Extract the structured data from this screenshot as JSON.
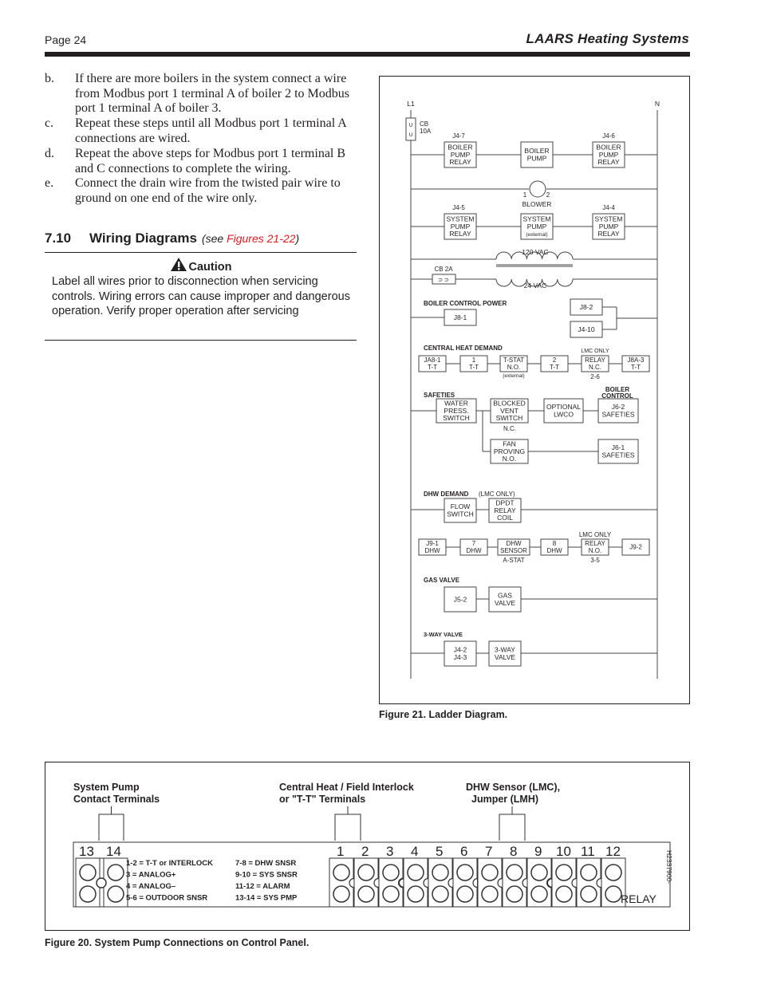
{
  "header": {
    "page_label": "Page 24",
    "brand": "LAARS Heating Systems"
  },
  "steps": [
    {
      "label": "b.",
      "text": "If there are more boilers in the system connect a wire from Modbus port 1 terminal A of boiler 2 to Modbus port 1 terminal A of boiler 3."
    },
    {
      "label": "c.",
      "text": "Repeat these steps until all Modbus port 1 terminal A connections are wired."
    },
    {
      "label": "d.",
      "text": "Repeat the above steps for Modbus port 1 terminal B and C connections to complete the wiring."
    },
    {
      "label": "e.",
      "text": "Connect the drain wire from the twisted pair wire to ground on one end of the wire only."
    }
  ],
  "section": {
    "number": "7.10",
    "title": "Wiring Diagrams",
    "see_prefix": "(see ",
    "see_ref": "Figures 21-22",
    "see_suffix": ")"
  },
  "caution": {
    "icon": "warning-triangle-icon",
    "title": "Caution",
    "body": "Label all wires prior to disconnection when servicing controls. Wiring errors can cause improper and dangerous operation. Verify proper operation after servicing"
  },
  "colors": {
    "text": "#231f20",
    "link_red": "#e21b23"
  },
  "figure21": {
    "caption": "Figure 21. Ladder Diagram.",
    "rails": {
      "left": "L1",
      "right": "N"
    },
    "cb10": [
      "CB",
      "10A"
    ],
    "rung1": {
      "left_tag": "J4-7",
      "left": [
        "BOILER",
        "PUMP",
        "RELAY"
      ],
      "mid": [
        "BOILER",
        "PUMP"
      ],
      "right_tag": "J4-6",
      "right": [
        "BOILER",
        "PUMP",
        "RELAY"
      ]
    },
    "blower": {
      "label": "BLOWER",
      "t1": "1",
      "t2": "2"
    },
    "rung3": {
      "left_tag": "J4-5",
      "left": [
        "SYSTEM",
        "PUMP",
        "RELAY"
      ],
      "mid": [
        "SYSTEM",
        "PUMP",
        "(external)"
      ],
      "right_tag": "J4-4",
      "right": [
        "SYSTEM",
        "PUMP",
        "RELAY"
      ]
    },
    "transformer": {
      "primary": "120 VAC",
      "secondary": "24 VAC"
    },
    "cb2": "CB 2A",
    "boiler_control_power": {
      "title": "BOILER CONTROL POWER",
      "left": "J8-1",
      "right_top": "J8-2",
      "right_bottom": "J4-10"
    },
    "central_heat": {
      "title": "CENTRAL HEAT DEMAND",
      "boxes": [
        [
          "JA8-1",
          "T-T"
        ],
        [
          "1",
          "T-T"
        ],
        [
          "T-STAT",
          "N.O."
        ],
        [
          "2",
          "T-T"
        ],
        [
          "RELAY",
          "N.C."
        ],
        [
          "J8A-3",
          "T-T"
        ]
      ],
      "tstat_note": "(external)",
      "relay_top": "LMC ONLY",
      "relay_bottom": "2-6"
    },
    "safeties": {
      "title": "SAFETIES",
      "boiler_control": [
        "BOILER",
        "CONTROL"
      ],
      "water": [
        "WATER",
        "PRESS.",
        "SWITCH"
      ],
      "blocked": [
        "BLOCKED",
        "VENT",
        "SWITCH"
      ],
      "blocked_note": "N.C.",
      "lwco": [
        "OPTIONAL",
        "LWCO"
      ],
      "j62": [
        "J6-2",
        "SAFETIES"
      ],
      "fan": [
        "FAN",
        "PROVING",
        "N.O."
      ],
      "j61": [
        "J6-1",
        "SAFETIES"
      ]
    },
    "dhw": {
      "title": "DHW DEMAND",
      "title_note": "(LMC ONLY)",
      "flow": [
        "FLOW",
        "SWITCH"
      ],
      "dpdt": [
        "DPDT",
        "RELAY",
        "COIL"
      ],
      "boxes": [
        [
          "J9-1",
          "DHW"
        ],
        [
          "7",
          "DHW"
        ],
        [
          "DHW",
          "SENSOR"
        ],
        [
          "8",
          "DHW"
        ],
        [
          "RELAY",
          "N.O."
        ],
        [
          "J9-2"
        ]
      ],
      "sensor_note": "A-STAT",
      "relay_top": "LMC ONLY",
      "relay_bottom": "3-5"
    },
    "gas_valve": {
      "title": "GAS VALVE",
      "left": "J5-2",
      "right": [
        "GAS",
        "VALVE"
      ]
    },
    "three_way": {
      "title": "3-WAY VALVE",
      "left": [
        "J4-2",
        "J4-3"
      ],
      "right": [
        "3-WAY",
        "VALVE"
      ]
    }
  },
  "figure20": {
    "caption": "Figure 20.  System Pump Connections on Control Panel.",
    "callouts": [
      {
        "lines": [
          "System Pump",
          "Contact Terminals"
        ]
      },
      {
        "lines": [
          "Central Heat / Field Interlock",
          "or \"T-T\" Terminals"
        ]
      },
      {
        "lines": [
          "DHW Sensor (LMC),",
          "Jumper (LMH)"
        ]
      }
    ],
    "left_block_numbers": [
      "13",
      "14"
    ],
    "main_block_numbers": [
      "1",
      "2",
      "3",
      "4",
      "5",
      "6",
      "7",
      "8",
      "9",
      "10",
      "11",
      "12"
    ],
    "legend_left": [
      "1-2 = T-T or INTERLOCK",
      "3    = ANALOG+",
      "4    = ANALOG–",
      "5-6 = OUTDOOR SNSR"
    ],
    "legend_right": [
      "7-8    = DHW SNSR",
      "9-10   = SYS SNSR",
      "11-12 = ALARM",
      "13-14 = SYS PMP"
    ],
    "relay_label": "RELAY",
    "part_number": "H2337900-"
  }
}
